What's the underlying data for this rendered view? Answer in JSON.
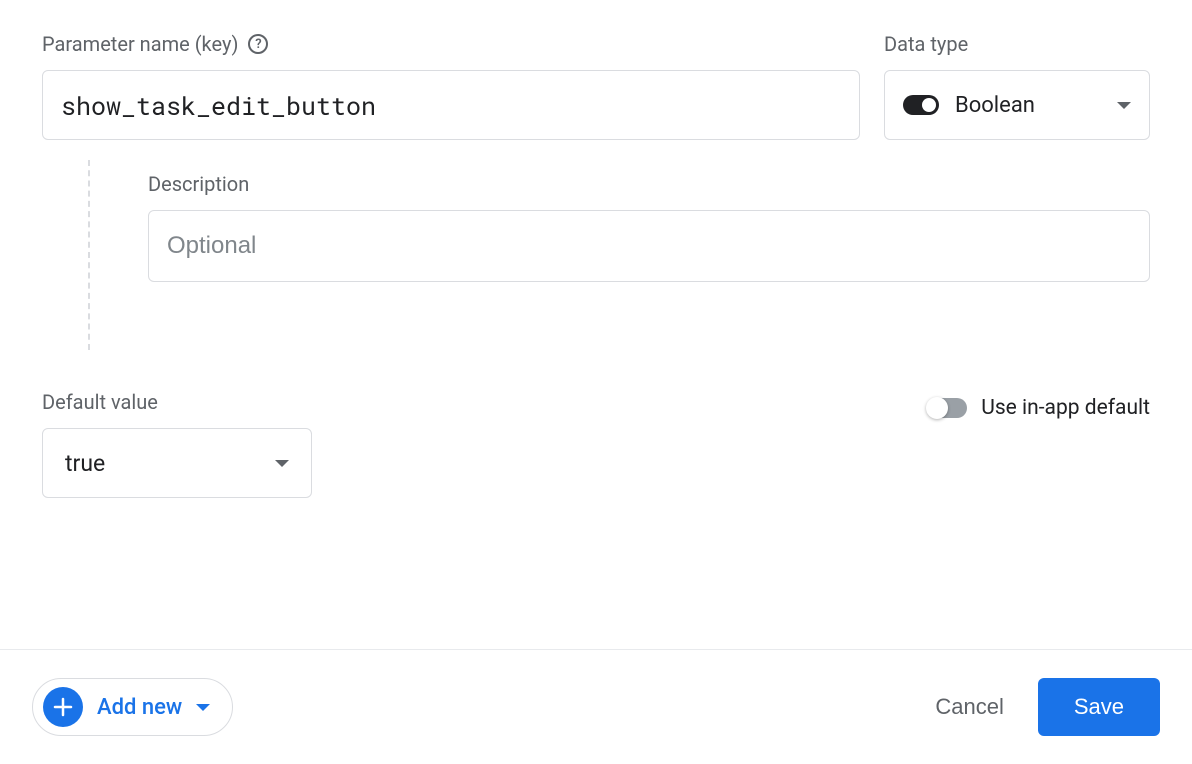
{
  "labels": {
    "parameter_name": "Parameter name (key)",
    "data_type": "Data type",
    "description": "Description",
    "default_value": "Default value",
    "use_in_app_default": "Use in-app default"
  },
  "parameter": {
    "name": "show_task_edit_button",
    "data_type": "Boolean",
    "description": "",
    "description_placeholder": "Optional",
    "default_value": "true",
    "use_in_app_default": false
  },
  "footer": {
    "add_new": "Add new",
    "cancel": "Cancel",
    "save": "Save"
  }
}
